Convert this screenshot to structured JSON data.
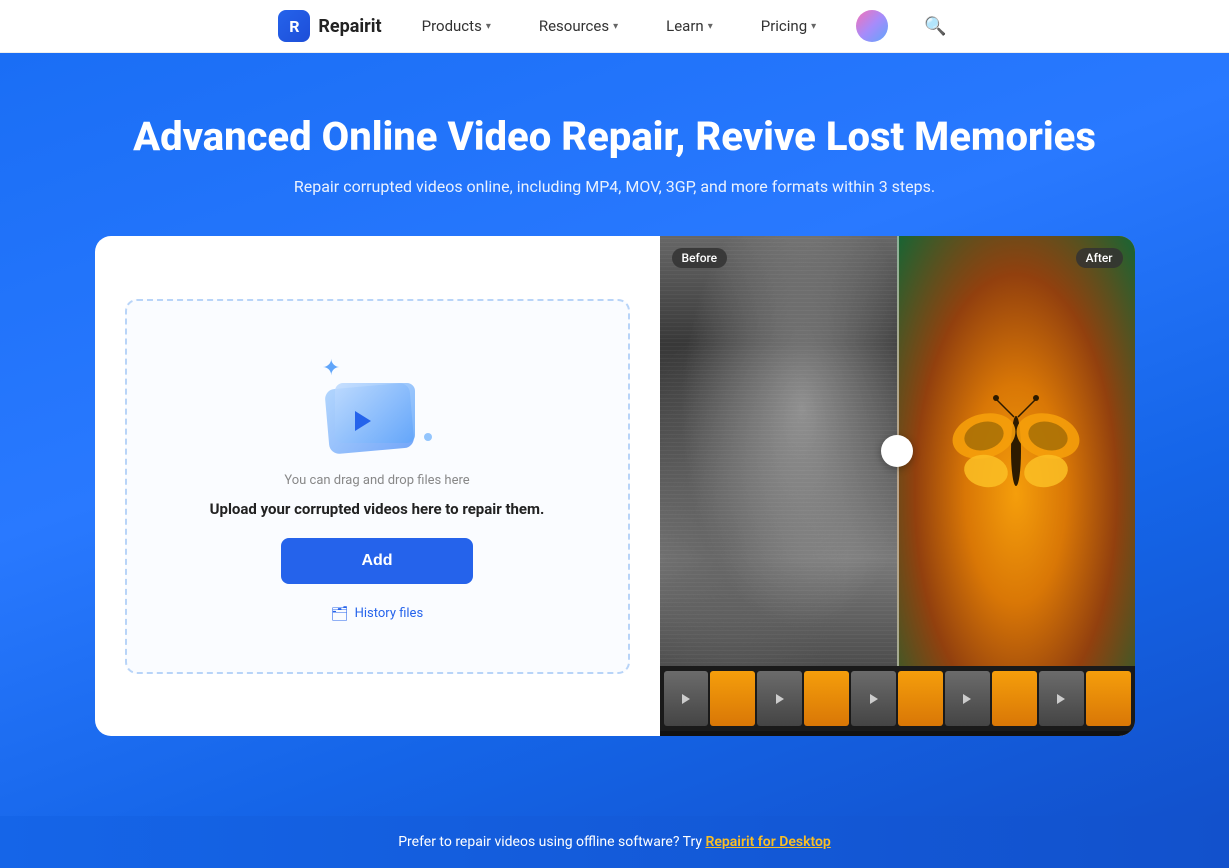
{
  "navbar": {
    "logo_text": "Repairit",
    "products_label": "Products",
    "resources_label": "Resources",
    "learn_label": "Learn",
    "pricing_label": "Pricing"
  },
  "hero": {
    "title": "Advanced Online Video Repair, Revive Lost Memories",
    "subtitle": "Repair corrupted videos online, including MP4, MOV, 3GP, and more formats within 3 steps."
  },
  "upload_panel": {
    "drag_drop_hint": "You can drag and drop files here",
    "upload_title": "Upload your corrupted videos here to repair them.",
    "add_button": "Add",
    "history_label": "History files"
  },
  "preview": {
    "before_label": "Before",
    "after_label": "After"
  },
  "bottom_bar": {
    "text": "Prefer to repair videos using offline software? Try ",
    "link_text": "Repairit for Desktop"
  }
}
